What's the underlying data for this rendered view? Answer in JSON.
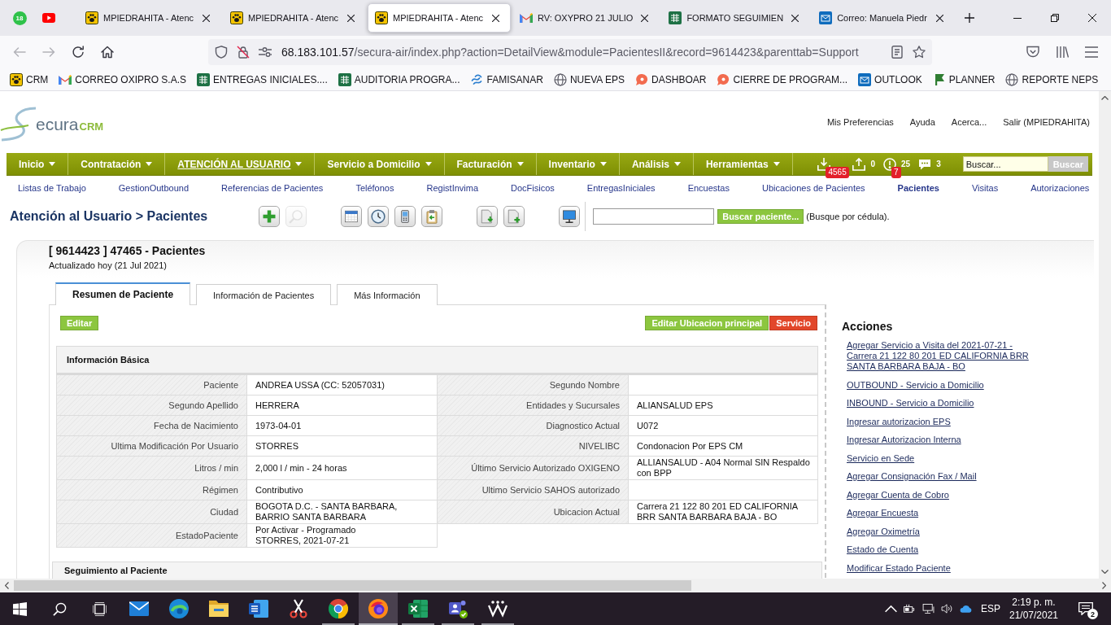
{
  "browser": {
    "pinned_tabs": [
      {
        "kind": "chat",
        "badge": "18"
      },
      {
        "kind": "video"
      }
    ],
    "tabs": [
      {
        "kind": "paw",
        "title": "MPIEDRAHITA - Atenc",
        "selected": false
      },
      {
        "kind": "paw",
        "title": "MPIEDRAHITA - Atenc",
        "selected": false
      },
      {
        "kind": "paw",
        "title": "MPIEDRAHITA - Atenc",
        "selected": true
      },
      {
        "kind": "mail",
        "title": "RV: OXYPRO 21 JULIO",
        "selected": false
      },
      {
        "kind": "sheet",
        "title": "FORMATO SEGUIMIEN",
        "selected": false
      },
      {
        "kind": "mailbox",
        "title": "Correo: Manuela Piedr",
        "selected": false
      }
    ],
    "nav_buttons": [
      {
        "kind": "back",
        "disabled": true
      },
      {
        "kind": "forward",
        "disabled": true
      },
      {
        "kind": "reload",
        "disabled": false
      },
      {
        "kind": "home",
        "disabled": false
      }
    ],
    "address": {
      "host": "68.183.101.57",
      "path": "/secura-air/index.php?action=DetailView&module=PacientesII&record=9614423&parenttab=Support"
    },
    "bookmarks": [
      {
        "kind": "paw",
        "label": "CRM"
      },
      {
        "kind": "mail",
        "label": "CORREO OXIPRO S.A.S"
      },
      {
        "kind": "sheet",
        "label": "ENTREGAS INICIALES...."
      },
      {
        "kind": "sheet",
        "label": "AUDITORIA PROGRA..."
      },
      {
        "kind": "swirl",
        "label": "FAMISANAR"
      },
      {
        "kind": "globe",
        "label": "NUEVA EPS"
      },
      {
        "kind": "bubble",
        "label": "DASHBOAR"
      },
      {
        "kind": "bubble",
        "label": "CIERRE DE PROGRAM..."
      },
      {
        "kind": "mailbox",
        "label": "OUTLOOK"
      },
      {
        "kind": "flag",
        "label": "PLANNER"
      },
      {
        "kind": "globe",
        "label": "REPORTE NEPS"
      }
    ]
  },
  "header": {
    "logo": {
      "text": "ecura",
      "suffix": "CRM"
    },
    "links": [
      "Mis Preferencias",
      "Ayuda",
      "Acerca...",
      "Salir (MPIEDRAHITA)"
    ]
  },
  "main_menu": [
    {
      "label": "Inicio",
      "selected": false
    },
    {
      "label": "Contratación",
      "selected": false
    },
    {
      "label": "ATENCIÓN AL USUARIO",
      "selected": true
    },
    {
      "label": "Servicio a Domicilio",
      "selected": false
    },
    {
      "label": "Facturación",
      "selected": false
    },
    {
      "label": "Inventario",
      "selected": false
    },
    {
      "label": "Análisis",
      "selected": false
    },
    {
      "label": "Herramientas",
      "selected": false
    }
  ],
  "notifications": [
    {
      "kind": "download",
      "badge": "4565"
    },
    {
      "kind": "upload",
      "count": "0"
    },
    {
      "kind": "alert",
      "count": "25",
      "badge": "7"
    },
    {
      "kind": "chat",
      "count": "3"
    }
  ],
  "menu_search": {
    "value": "Buscar...",
    "button": "Buscar"
  },
  "sub_menu": [
    {
      "label": "Listas de Trabajo",
      "selected": false
    },
    {
      "label": "GestionOutbound",
      "selected": false
    },
    {
      "label": "Referencias de Pacientes",
      "selected": false
    },
    {
      "label": "Teléfonos",
      "selected": false
    },
    {
      "label": "RegistInvima",
      "selected": false
    },
    {
      "label": "DocFisicos",
      "selected": false
    },
    {
      "label": "EntregasIniciales",
      "selected": false
    },
    {
      "label": "Encuestas",
      "selected": false
    },
    {
      "label": "Ubicaciones de Pacientes",
      "selected": false
    },
    {
      "label": "Pacientes",
      "selected": true
    },
    {
      "label": "Visitas",
      "selected": false
    },
    {
      "label": "Autorizaciones",
      "selected": false
    }
  ],
  "breadcrumb": "Atención al Usuario > Pacientes",
  "toolbar": [
    {
      "buttons": [
        {
          "kind": "add",
          "disabled": false
        },
        {
          "kind": "find",
          "disabled": true
        }
      ]
    },
    {
      "buttons": [
        {
          "kind": "window",
          "disabled": false
        },
        {
          "kind": "clock",
          "disabled": false
        },
        {
          "kind": "phone",
          "disabled": false
        },
        {
          "kind": "clipboard",
          "disabled": false
        }
      ]
    },
    {
      "buttons": [
        {
          "kind": "import",
          "disabled": false
        },
        {
          "kind": "newdoc",
          "disabled": false
        }
      ]
    },
    {
      "buttons": [
        {
          "kind": "monitor",
          "disabled": false
        }
      ]
    }
  ],
  "patient_search": {
    "button": "Buscar paciente...",
    "hint": "(Busque por cédula)."
  },
  "record": {
    "title": "[ 9614423 ] 47465 - Pacientes",
    "updated": "Actualizado hoy (21 Jul 2021)"
  },
  "tabs": [
    {
      "label": "Resumen de Paciente",
      "selected": true
    },
    {
      "label": "Información de Pacientes",
      "selected": false
    },
    {
      "label": "Más Información",
      "selected": false
    }
  ],
  "edit_button": "Editar",
  "actions": [
    {
      "label": "Editar Ubicacion principal",
      "kind": "normal"
    },
    {
      "label": "Servicio",
      "kind": "danger"
    }
  ],
  "basic_info": {
    "title": "Información Básica",
    "rows": [
      {
        "cells": [
          {
            "label": "Paciente",
            "lines": [
              "ANDREA USSA (CC: 52057031)"
            ]
          },
          {
            "label": "Segundo Nombre"
          }
        ]
      },
      {
        "cells": [
          {
            "label": "Segundo Apellido",
            "lines": [
              "HERRERA"
            ]
          },
          {
            "label": "Entidades y Sucursales",
            "lines": [
              "ALIANSALUD EPS"
            ]
          }
        ]
      },
      {
        "cells": [
          {
            "label": "Fecha de Nacimiento",
            "lines": [
              "1973-04-01"
            ]
          },
          {
            "label": "Diagnostico Actual",
            "lines": [
              "U072"
            ]
          }
        ]
      },
      {
        "cells": [
          {
            "label": "Ultima Modificación Por Usuario",
            "lines": [
              "STORRES"
            ]
          },
          {
            "label": "NIVELIBC",
            "lines": [
              "Condonacion Por EPS CM"
            ]
          }
        ]
      },
      {
        "cells": [
          {
            "label": "Litros / min",
            "lines": [
              "2,000 l / min - 24 horas"
            ]
          },
          {
            "label": "Último Servicio Autorizado OXIGENO",
            "lines": [
              "ALLIANSALUD - A04 Normal SIN Respaldo",
              "con BPP"
            ]
          }
        ]
      },
      {
        "cells": [
          {
            "label": "Régimen",
            "lines": [
              "Contributivo"
            ]
          },
          {
            "label": "Ultimo Servicio SAHOS autorizado"
          }
        ]
      },
      {
        "cells": [
          {
            "label": "Ciudad",
            "lines": [
              "BOGOTA D.C. - SANTA BARBARA,",
              "BARRIO SANTA BARBARA"
            ]
          },
          {
            "label": "Ubicacion Actual",
            "lines": [
              "Carrera 21 122 80 201 ED CALIFORNIA",
              "BRR SANTA BARBARA BAJA - BO"
            ]
          }
        ]
      },
      {
        "cells": [
          {
            "label": "EstadoPaciente",
            "lines": [
              "Por Activar - Programado",
              "STORRES, 2021-07-21"
            ]
          }
        ]
      }
    ]
  },
  "follow_up": {
    "title": "Seguimiento al Paciente"
  },
  "side_actions": {
    "title": "Acciones",
    "links": [
      "Agregar Servicio a Visita del 2021-07-21 - Carrera 21 122 80 201 ED CALIFORNIA BRR SANTA BARBARA BAJA - BO",
      "OUTBOUND - Servicio a Domicilio",
      "INBOUND - Servicio a Domicilio",
      "Ingresar autorizacion EPS",
      "Ingresar Autorizacion Interna",
      "Servicio en Sede",
      "Agregar Consignación Fax / Mail",
      "Agregar Cuenta de Cobro",
      "Agregar Encuesta",
      "Agregar Oximetría",
      "Estado de Cuenta",
      "Modificar Estado Paciente"
    ]
  },
  "taskbar": {
    "apps": [
      {
        "kind": "start",
        "running": false,
        "selected": false
      },
      {
        "kind": "search",
        "running": false,
        "selected": false
      },
      {
        "kind": "taskview",
        "running": false,
        "selected": false
      },
      {
        "kind": "mail",
        "running": false,
        "selected": false
      },
      {
        "kind": "wave",
        "running": false,
        "selected": false
      },
      {
        "kind": "folder",
        "running": false,
        "selected": false
      },
      {
        "kind": "document",
        "running": false,
        "selected": false
      },
      {
        "kind": "scissors",
        "running": false,
        "selected": false
      },
      {
        "kind": "wheel",
        "running": true,
        "selected": false
      },
      {
        "kind": "fox",
        "running": true,
        "selected": true
      },
      {
        "kind": "sheet",
        "running": true,
        "selected": false
      },
      {
        "kind": "team",
        "running": true,
        "selected": false
      },
      {
        "kind": "zigzag",
        "running": true,
        "selected": false
      }
    ],
    "tray": [
      {
        "kind": "chevron"
      },
      {
        "kind": "battery"
      },
      {
        "kind": "network"
      },
      {
        "kind": "volume"
      },
      {
        "kind": "cloud"
      }
    ],
    "language": "ESP",
    "time": "2:19 p. m.",
    "date": "21/07/2021",
    "notifications": "2"
  }
}
